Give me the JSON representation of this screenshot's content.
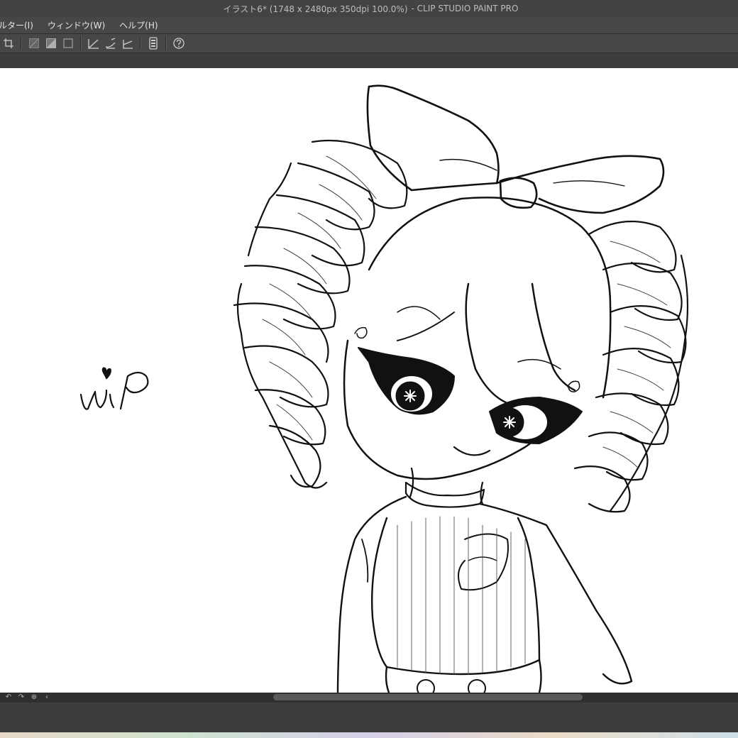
{
  "window": {
    "title": "イラスト6* (1748 x 2480px 350dpi 100.0%)",
    "app_name": "- CLIP STUDIO PAINT PRO"
  },
  "menu": {
    "items": [
      {
        "label": "ルター(I)"
      },
      {
        "label": "ウィンドウ(W)"
      },
      {
        "label": "ヘルプ(H)"
      }
    ]
  },
  "toolbar": {
    "icons": [
      "crop-selection-icon",
      "clear-outside-selection-icon",
      "fill-selection-icon",
      "deselect-icon",
      "ruler-icon",
      "special-ruler-icon",
      "perspective-ruler-icon",
      "smartphone-icon",
      "help-icon"
    ]
  },
  "canvas": {
    "wip_text": "wip",
    "background": "#ffffff",
    "ink": "#111111"
  },
  "navigator": {
    "buttons": [
      "undo-icon",
      "redo-icon",
      "reset-view-icon",
      "collapse-icon"
    ]
  }
}
